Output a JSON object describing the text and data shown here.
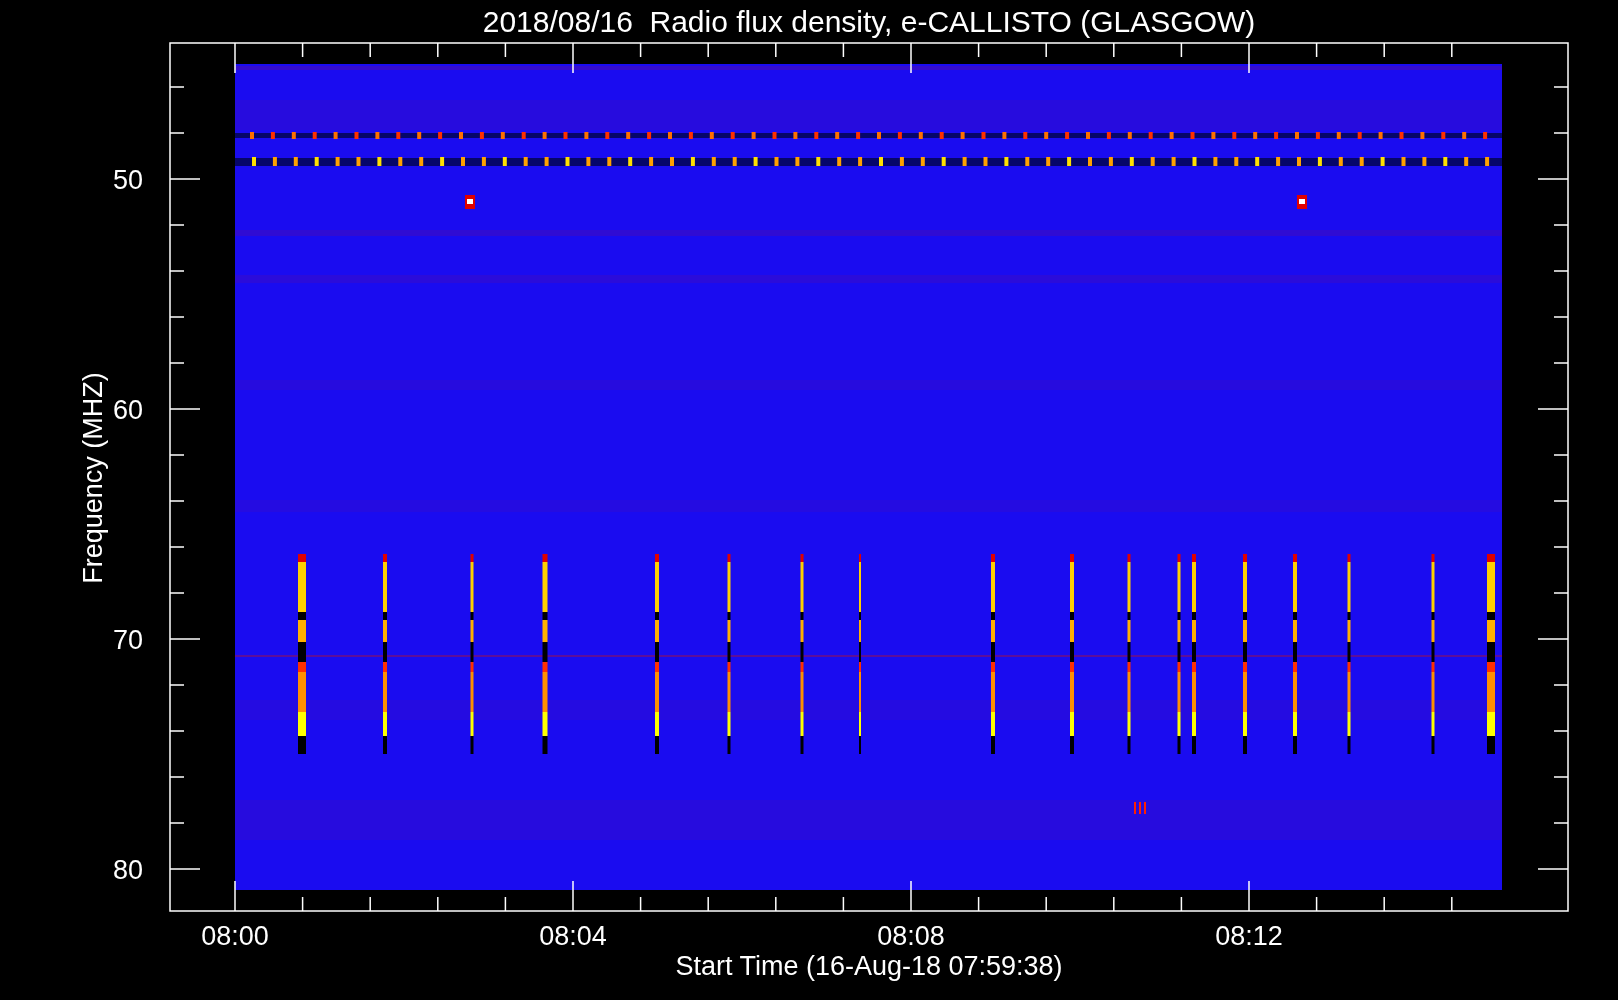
{
  "title": "2018/08/16  Radio flux density, e-CALLISTO (GLASGOW)",
  "ylabel": "Frequency (MHZ)",
  "xlabel": "Start Time (16-Aug-18 07:59:38)",
  "yticks": [
    "50",
    "60",
    "70",
    "80"
  ],
  "xticks": [
    "08:00",
    "08:04",
    "08:08",
    "08:12"
  ]
}
